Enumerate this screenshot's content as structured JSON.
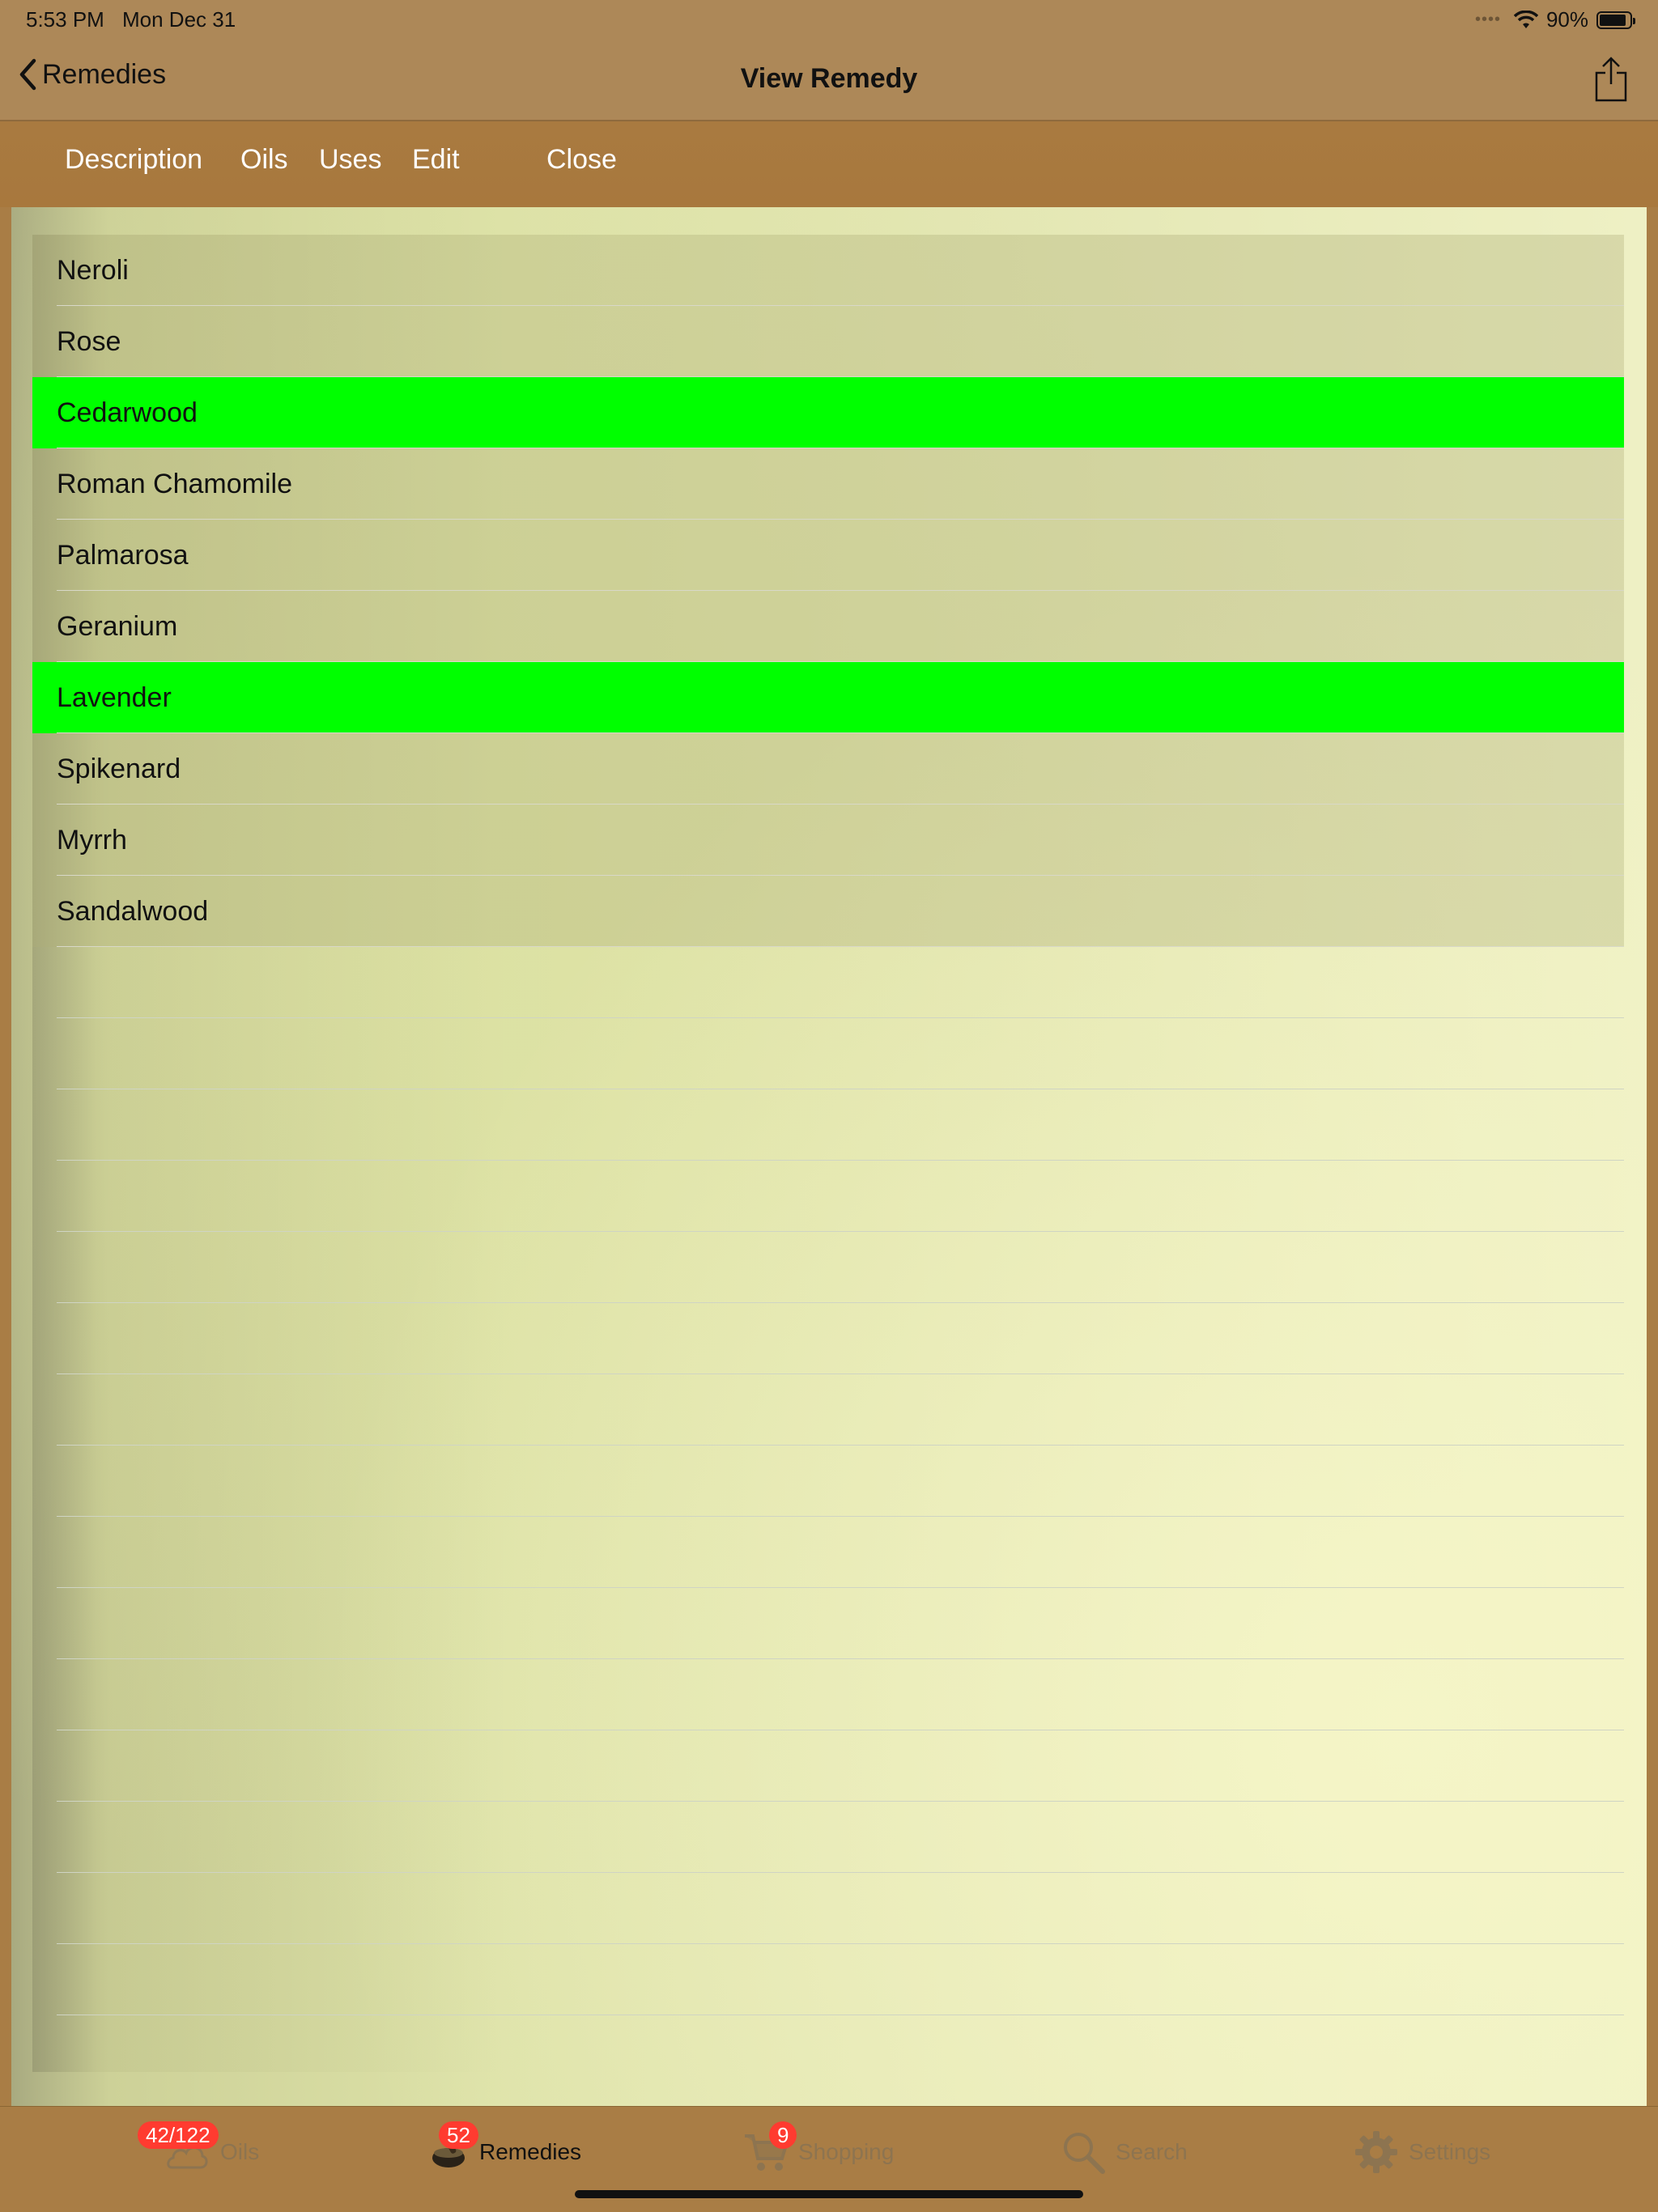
{
  "status_bar": {
    "time": "5:53 PM",
    "date": "Mon Dec 31",
    "battery": "90%",
    "battery_level": 0.9
  },
  "nav": {
    "back_label": "Remedies",
    "title": "View Remedy"
  },
  "segments": {
    "description": "Description",
    "oils": "Oils",
    "uses": "Uses",
    "edit": "Edit",
    "close": "Close"
  },
  "oils_list": [
    {
      "name": "Neroli",
      "highlighted": false
    },
    {
      "name": "Rose",
      "highlighted": false
    },
    {
      "name": "Cedarwood",
      "highlighted": true
    },
    {
      "name": "Roman Chamomile",
      "highlighted": false
    },
    {
      "name": "Palmarosa",
      "highlighted": false
    },
    {
      "name": "Geranium",
      "highlighted": false
    },
    {
      "name": "Lavender",
      "highlighted": true
    },
    {
      "name": "Spikenard",
      "highlighted": false
    },
    {
      "name": "Myrrh",
      "highlighted": false
    },
    {
      "name": "Sandalwood",
      "highlighted": false
    }
  ],
  "highlight_color": "#00ff00",
  "tabs": {
    "oils": {
      "label": "Oils",
      "badge": "42/122"
    },
    "remedies": {
      "label": "Remedies",
      "badge": "52"
    },
    "shopping": {
      "label": "Shopping",
      "badge": "9"
    },
    "search": {
      "label": "Search"
    },
    "settings": {
      "label": "Settings"
    }
  }
}
